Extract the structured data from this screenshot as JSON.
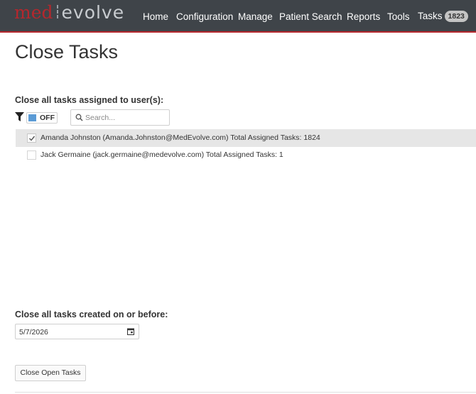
{
  "app": {
    "logo_part1": "med",
    "logo_part2": "evolve"
  },
  "nav": {
    "items": [
      "Home",
      "Configuration",
      "Manage",
      "Patient Search",
      "Reports",
      "Tools",
      "Tasks"
    ],
    "tasks_badge": "1823"
  },
  "page": {
    "title": "Close Tasks"
  },
  "users_section": {
    "label": "Close all tasks assigned to user(s):",
    "toggle_label": "OFF",
    "search_placeholder": "Search...",
    "users": [
      {
        "text": "Amanda Johnston (Amanda.Johnston@MedEvolve.com) Total Assigned Tasks: 1824",
        "checked": true
      },
      {
        "text": "Jack Germaine (jack.germaine@medevolve.com) Total Assigned Tasks: 1",
        "checked": false
      }
    ]
  },
  "date_section": {
    "label": "Close all tasks created on or before:",
    "value": "5/7/2026"
  },
  "actions": {
    "close_button": "Close Open Tasks"
  },
  "colors": {
    "navbar": "#3f4449",
    "brand_red": "#b5272d",
    "toggle_blue": "#5b9bd5",
    "selected_row": "#e6e6e6"
  },
  "icons": [
    "filter-icon",
    "search-icon",
    "checkmark-icon",
    "calendar-icon"
  ]
}
